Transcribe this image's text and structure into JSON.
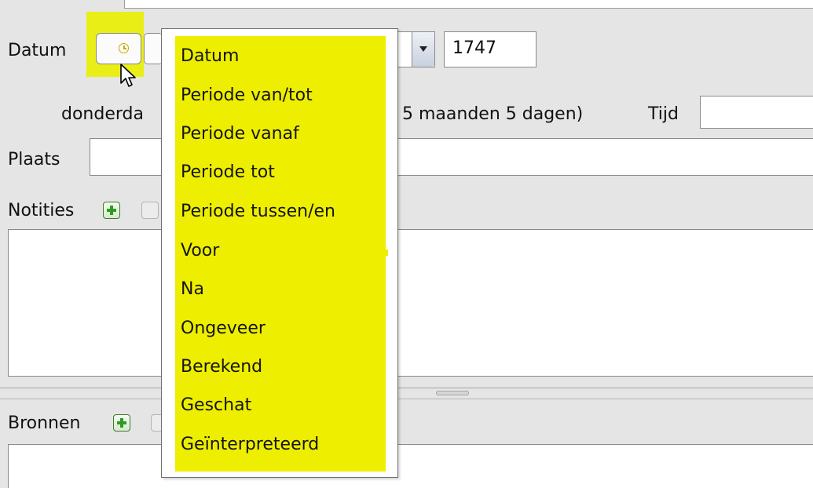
{
  "datum_label": "Datum",
  "year_value": "1747",
  "weekday_text": "donderda",
  "duration_text": "5 maanden 5 dagen)",
  "time_label": "Tijd",
  "place_label": "Plaats",
  "notes_label": "Notities",
  "sources_label": "Bronnen",
  "highlight_color": "#eeee00",
  "popup_menu": {
    "items": [
      {
        "label": "Datum"
      },
      {
        "label": "Periode van/tot"
      },
      {
        "label": "Periode vanaf"
      },
      {
        "label": "Periode tot"
      },
      {
        "label": "Periode tussen/en"
      },
      {
        "label": "Voor"
      },
      {
        "label": "Na"
      },
      {
        "label": "Ongeveer"
      },
      {
        "label": "Berekend"
      },
      {
        "label": "Geschat"
      },
      {
        "label": "Geïnterpreteerd"
      }
    ]
  }
}
